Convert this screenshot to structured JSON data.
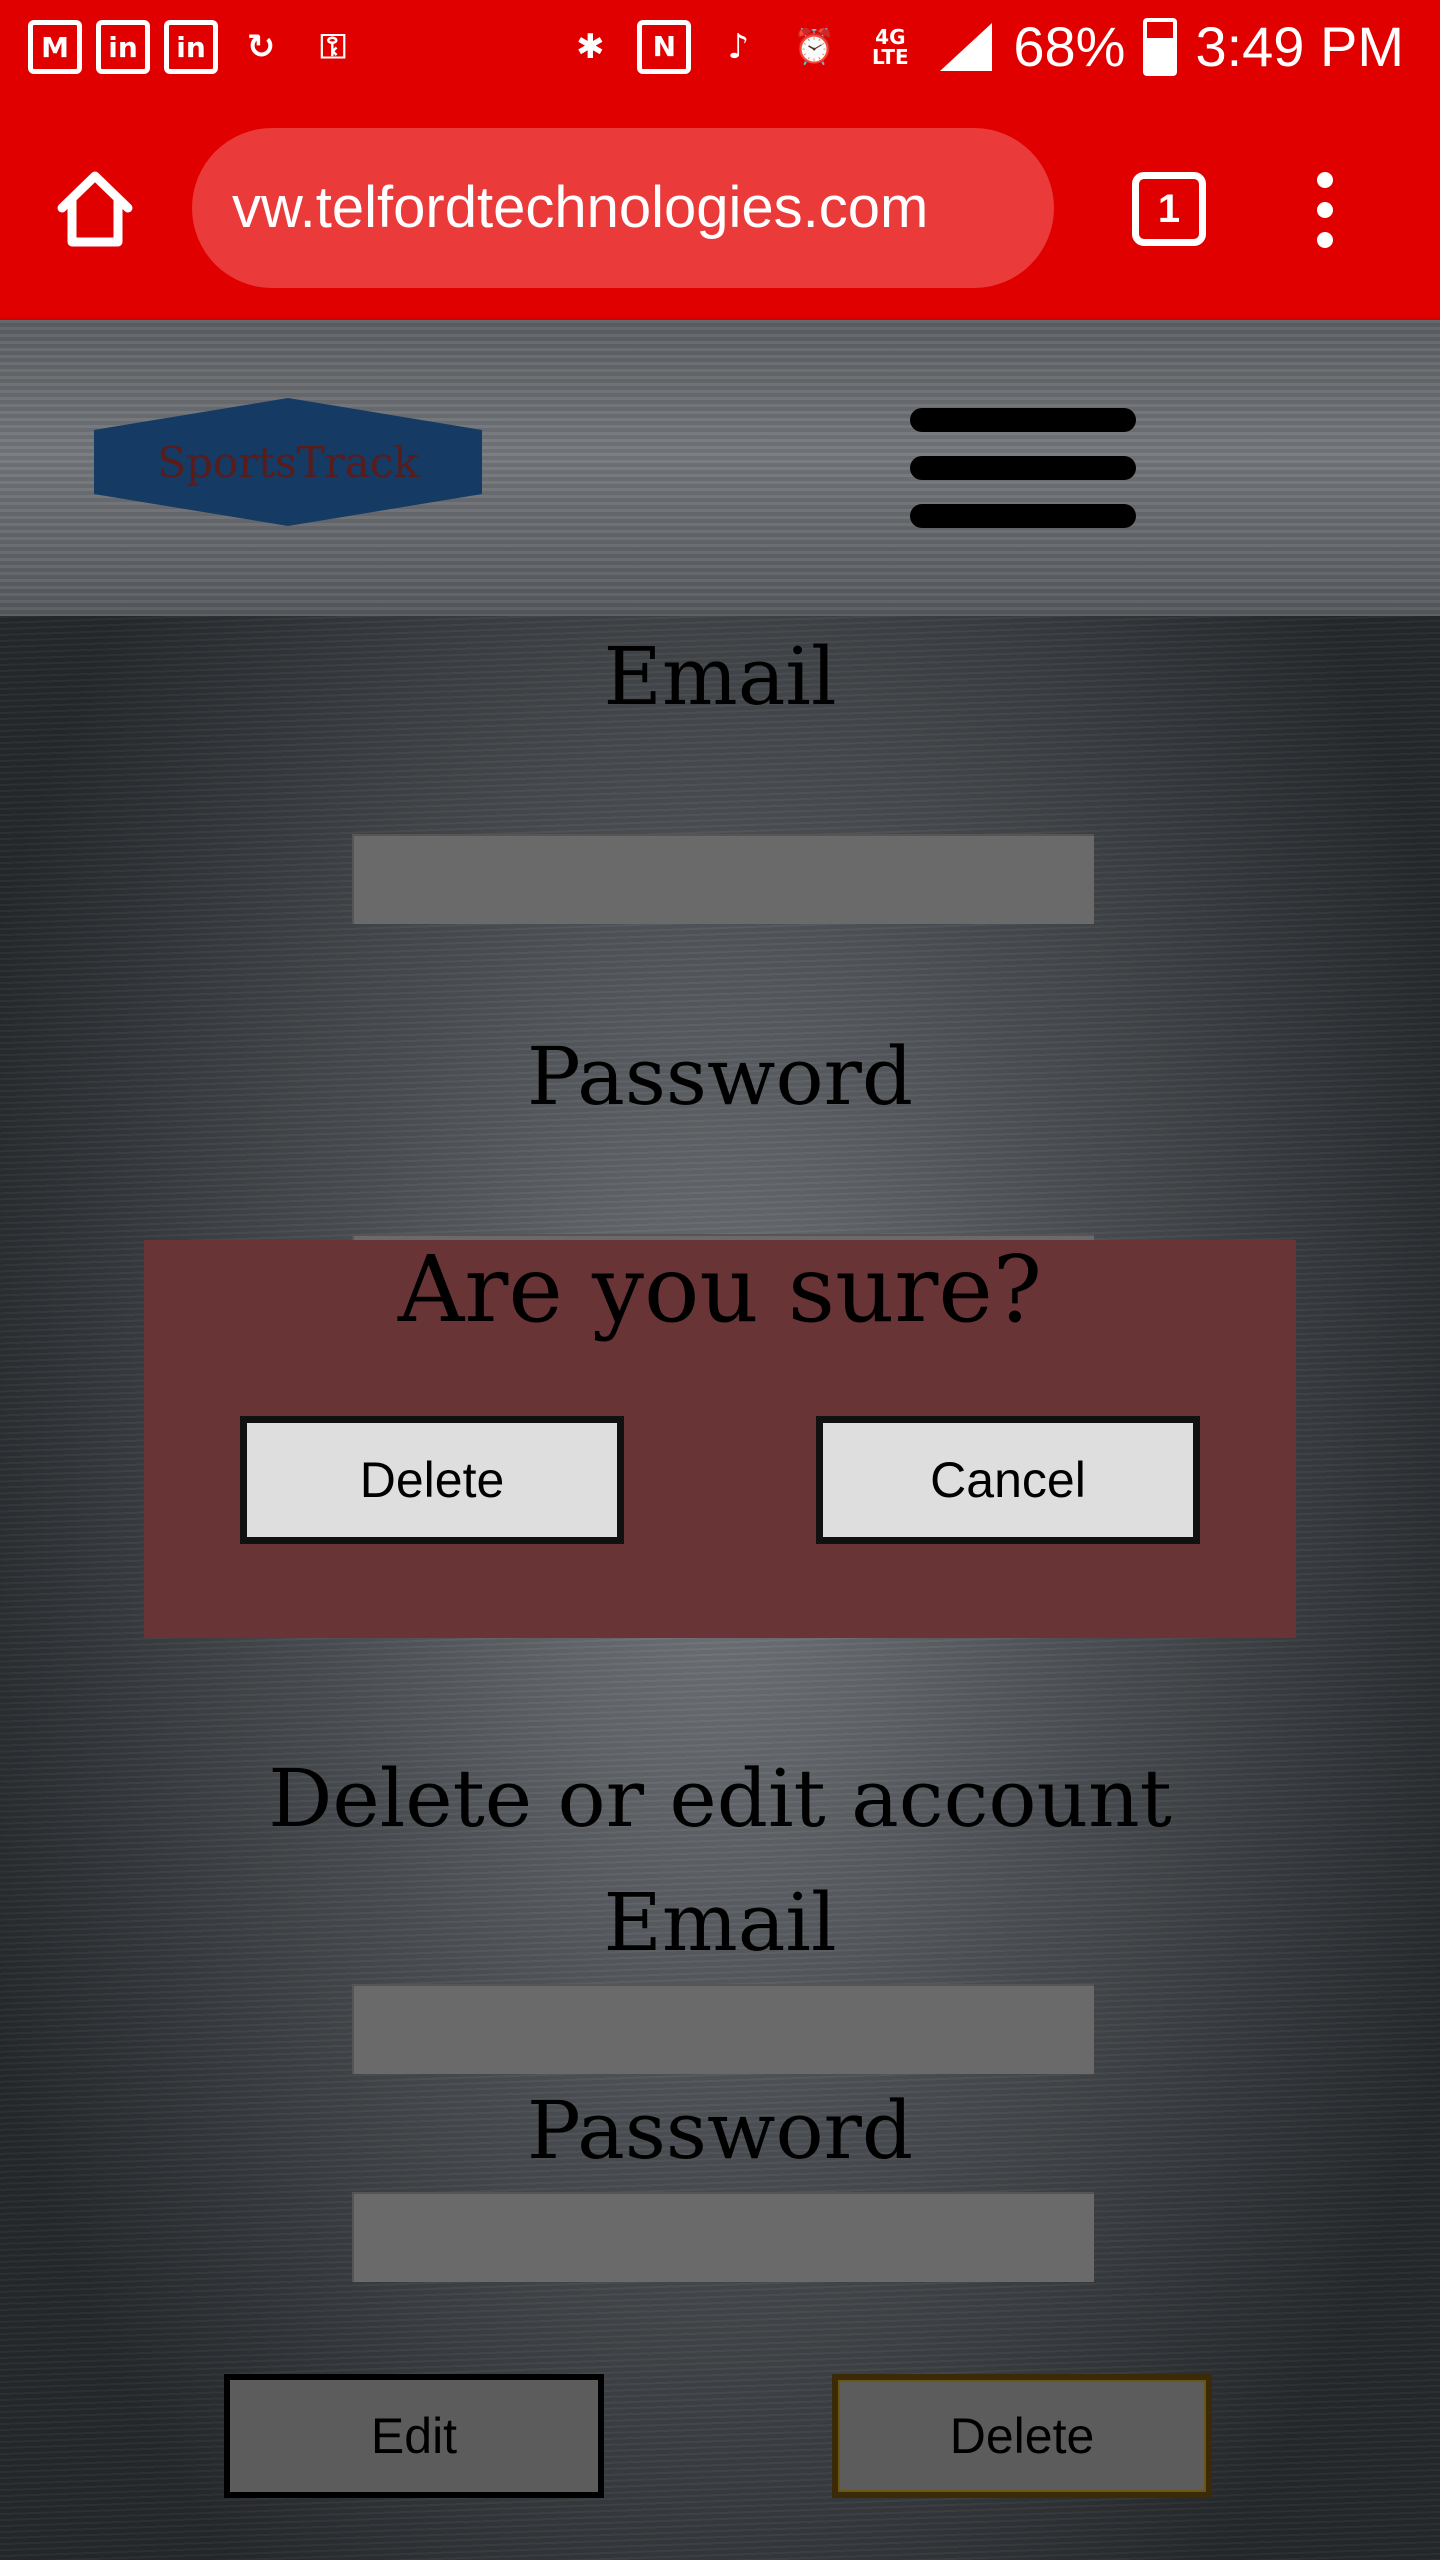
{
  "status_bar": {
    "left_icons": [
      "gmail-icon",
      "linkedin-icon",
      "linkedin-icon",
      "sync-icon",
      "key-icon"
    ],
    "right_icons": [
      "bluetooth-icon",
      "nfc-icon",
      "mute-icon",
      "alarm-icon",
      "lte-icon",
      "signal-icon"
    ],
    "battery_percent": "68%",
    "battery_level": 0.68,
    "time": "3:49 PM"
  },
  "browser": {
    "url": "vw.telfordtechnologies.com",
    "tab_count": "1"
  },
  "header": {
    "logo_text": "SportsTrack"
  },
  "form_top": {
    "email_label": "Email",
    "password_label": "Password"
  },
  "modal": {
    "title": "Are you sure?",
    "delete_label": "Delete",
    "cancel_label": "Cancel"
  },
  "form_bottom": {
    "heading": "Delete or edit account",
    "email_label": "Email",
    "password_label": "Password",
    "edit_label": "Edit",
    "delete_label": "Delete"
  },
  "colors": {
    "browser_red": "#e00000",
    "modal_bg": "#693436",
    "logo_bg": "#153a63"
  }
}
